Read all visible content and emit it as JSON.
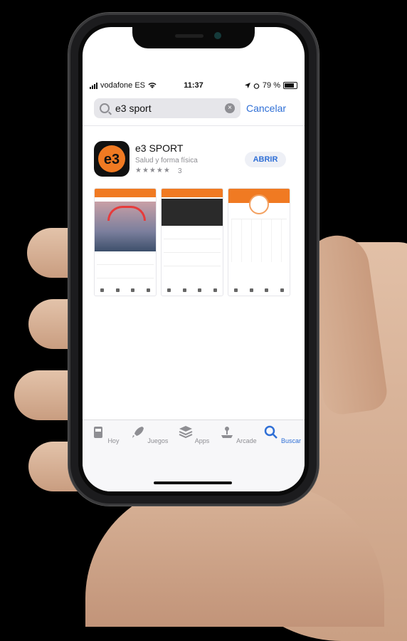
{
  "statusbar": {
    "carrier": "vodafone ES",
    "time": "11:37",
    "battery": "79 %"
  },
  "search": {
    "query": "e3 sport",
    "cancel_label": "Cancelar"
  },
  "app": {
    "name": "e3 SPORT",
    "category": "Salud y forma física",
    "stars": "★★★★★",
    "rating_count": "3",
    "get_label": "ABRIR",
    "icon_text": "e3"
  },
  "tabs": [
    {
      "label": "Hoy",
      "icon": "today-icon"
    },
    {
      "label": "Juegos",
      "icon": "rocket-icon"
    },
    {
      "label": "Apps",
      "icon": "layers-icon"
    },
    {
      "label": "Arcade",
      "icon": "joystick-icon"
    },
    {
      "label": "Buscar",
      "icon": "search-icon"
    }
  ],
  "colors": {
    "accent": "#2f6fd6",
    "brand_orange": "#f07a22"
  }
}
